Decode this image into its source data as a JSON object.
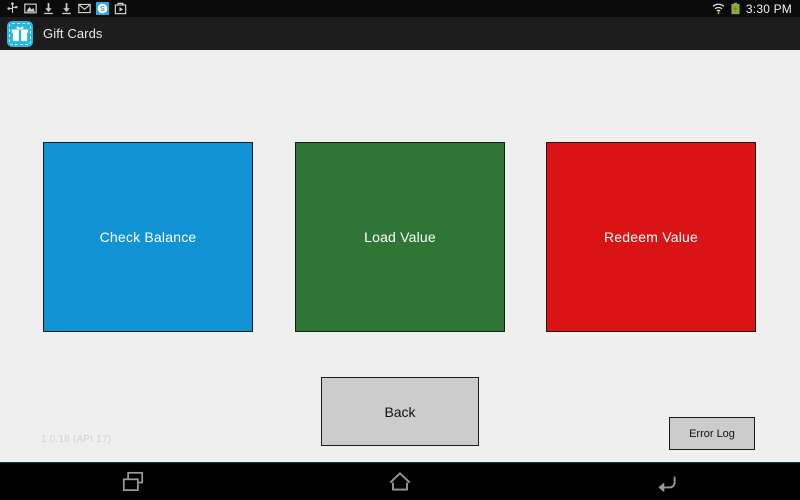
{
  "status_bar": {
    "icons": [
      {
        "name": "usb-icon",
        "glyph": "usb"
      },
      {
        "name": "screenshot-image-icon",
        "glyph": "image"
      },
      {
        "name": "download-icon",
        "glyph": "download"
      },
      {
        "name": "download-icon-2",
        "glyph": "download"
      },
      {
        "name": "email-icon",
        "glyph": "envelope"
      },
      {
        "name": "skype-icon",
        "glyph": "skype"
      },
      {
        "name": "play-store-icon",
        "glyph": "play-bag"
      }
    ],
    "wifi_icon": "wifi-icon",
    "battery_icon": "battery-charging-icon",
    "clock": "3:30 PM"
  },
  "action_bar": {
    "app_icon": "gift-icon",
    "title": "Gift Cards"
  },
  "main": {
    "tiles": [
      {
        "name": "check-balance",
        "label": "Check Balance",
        "color": "#1192d4"
      },
      {
        "name": "load-value",
        "label": "Load Value",
        "color": "#2f7535"
      },
      {
        "name": "redeem-value",
        "label": "Redeem Value",
        "color": "#da1414"
      }
    ],
    "back_button": "Back",
    "error_log_button": "Error Log",
    "version": "1.0.18 (API 17)"
  },
  "nav_bar": {
    "recents": "recents-icon",
    "home": "home-icon",
    "back": "back-icon"
  }
}
